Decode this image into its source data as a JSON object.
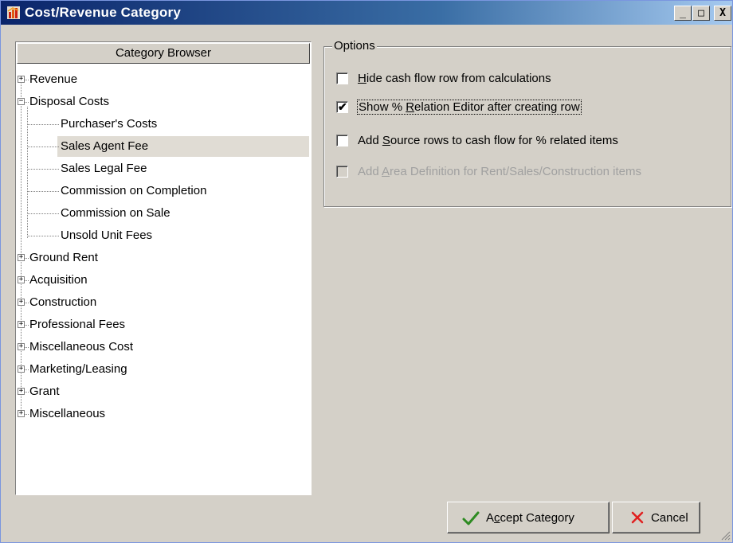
{
  "window": {
    "title": "Cost/Revenue Category",
    "buttons": {
      "minimize": "_",
      "maximize": "□",
      "close": "X"
    }
  },
  "tree": {
    "header": "Category Browser",
    "items": [
      {
        "label": "Revenue",
        "expanded": false,
        "level": 0
      },
      {
        "label": "Disposal Costs",
        "expanded": true,
        "level": 0
      },
      {
        "label": "Purchaser's Costs",
        "level": 1
      },
      {
        "label": "Sales Agent Fee",
        "level": 1,
        "selected": true
      },
      {
        "label": "Sales Legal Fee",
        "level": 1
      },
      {
        "label": "Commission on Completion",
        "level": 1
      },
      {
        "label": "Commission on Sale",
        "level": 1
      },
      {
        "label": "Unsold Unit Fees",
        "level": 1
      },
      {
        "label": "Ground Rent",
        "expanded": false,
        "level": 0
      },
      {
        "label": "Acquisition",
        "expanded": false,
        "level": 0
      },
      {
        "label": "Construction",
        "expanded": false,
        "level": 0
      },
      {
        "label": "Professional Fees",
        "expanded": false,
        "level": 0
      },
      {
        "label": "Miscellaneous Cost",
        "expanded": false,
        "level": 0
      },
      {
        "label": "Marketing/Leasing",
        "expanded": false,
        "level": 0
      },
      {
        "label": "Grant",
        "expanded": false,
        "level": 0
      },
      {
        "label": "Miscellaneous",
        "expanded": false,
        "level": 0
      }
    ]
  },
  "options": {
    "legend": "Options",
    "checkboxes": [
      {
        "pre": "",
        "accel": "H",
        "post": "ide cash flow row from calculations",
        "checked": false,
        "enabled": true
      },
      {
        "pre": "Show % ",
        "accel": "R",
        "post": "elation Editor after creating row",
        "checked": true,
        "enabled": true
      },
      {
        "pre": "Add ",
        "accel": "S",
        "post": "ource rows to cash flow for % related items",
        "checked": false,
        "enabled": true
      },
      {
        "pre": "Add ",
        "accel": "A",
        "post": "rea Definition for Rent/Sales/Construction items",
        "checked": false,
        "enabled": false
      }
    ]
  },
  "buttons": {
    "accept": {
      "pre": "A",
      "accel": "c",
      "post": "cept Category",
      "icon": "check-icon"
    },
    "cancel": {
      "label": "Cancel",
      "icon": "x-icon"
    }
  },
  "colors": {
    "title_gradient_start": "#0a246a",
    "title_gradient_end": "#a6caf0",
    "face": "#d4d0c8",
    "selected_row": "#e0dcd4",
    "check_green": "#2e8b22",
    "cancel_red": "#e02020"
  }
}
